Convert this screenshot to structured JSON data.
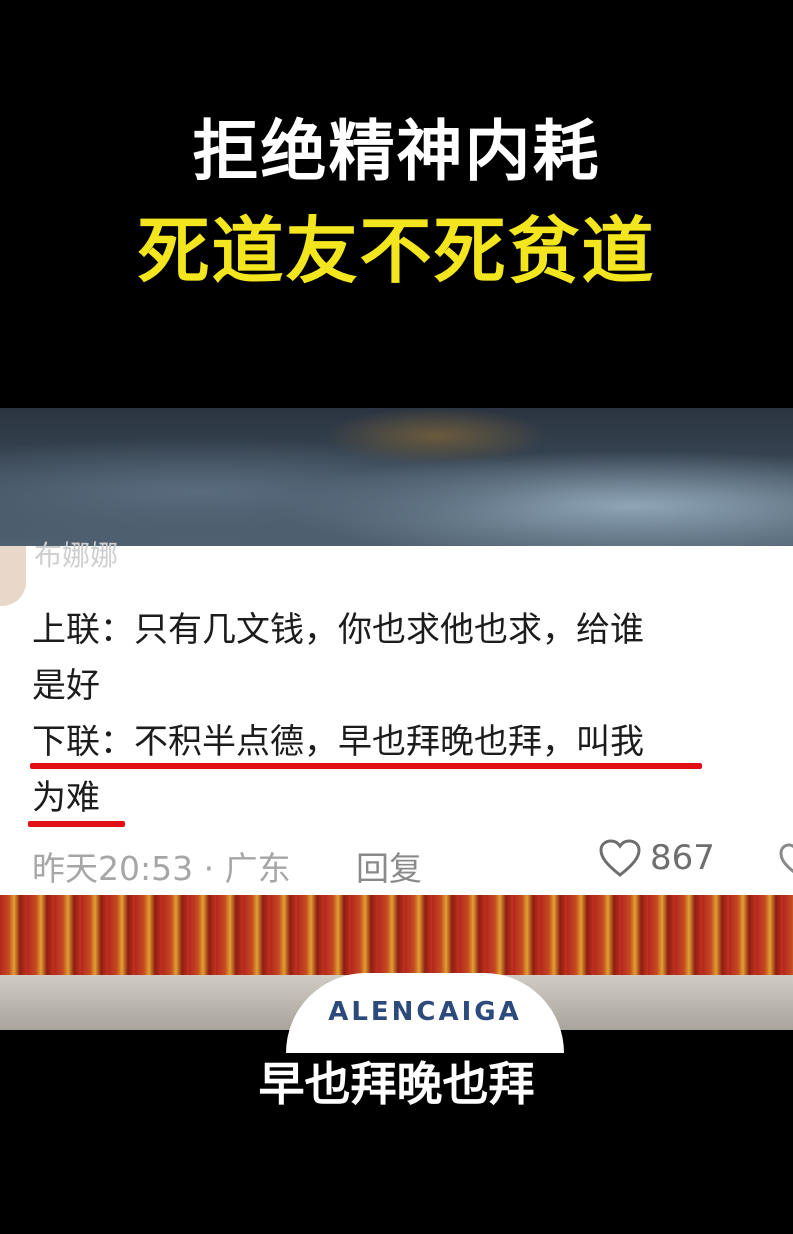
{
  "headline": {
    "line1": "拒绝精神内耗",
    "line2": "死道友不死贫道"
  },
  "comment": {
    "username": "布娜娜",
    "lines": [
      "上联：只有几文钱，你也求他也求，给谁",
      "是好",
      "下联：不积半点德，早也拜晚也拜，叫我",
      "为难"
    ],
    "meta": "昨天20:53 · 广东",
    "reply_label": "回复",
    "like_count": "867"
  },
  "scene": {
    "cap_text": "ALENCAIGA"
  },
  "subtitle": "早也拜晚也拜",
  "colors": {
    "headline_yellow": "#f3e61f",
    "underline_red": "#e20f15"
  }
}
